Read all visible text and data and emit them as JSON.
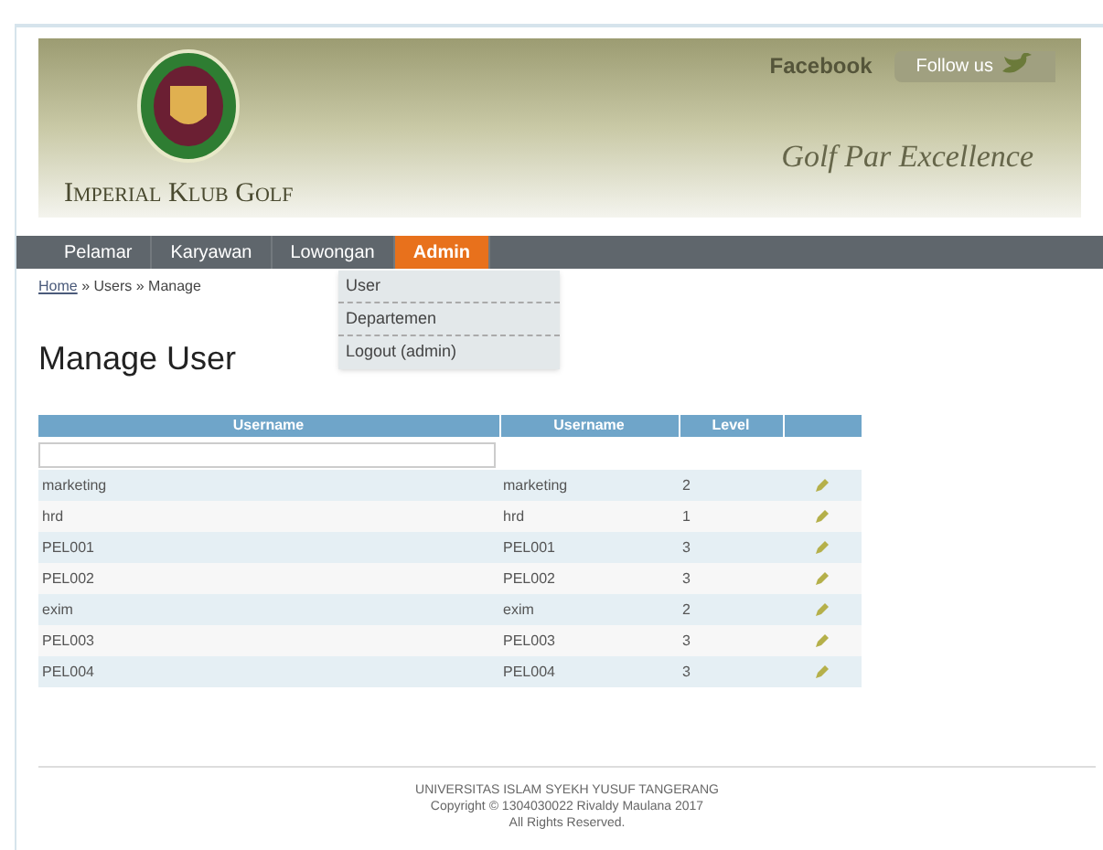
{
  "header": {
    "brand": "Imperial Klub Golf",
    "facebook": "Facebook",
    "follow": "Follow us",
    "tagline": "Golf Par Excellence"
  },
  "nav": [
    {
      "label": "Pelamar",
      "selected": false
    },
    {
      "label": "Karyawan",
      "selected": false
    },
    {
      "label": "Lowongan",
      "selected": false
    },
    {
      "label": "Admin",
      "selected": true
    }
  ],
  "dropdown": [
    "User",
    "Departemen",
    "Logout (admin)"
  ],
  "breadcrumb": {
    "home": "Home",
    "rest": "» Users » Manage"
  },
  "title": "Manage User",
  "table": {
    "columns": [
      "Username",
      "Username",
      "Level"
    ],
    "rows": [
      {
        "cells": [
          "marketing",
          "marketing",
          "2"
        ]
      },
      {
        "cells": [
          "hrd",
          "hrd",
          "1"
        ]
      },
      {
        "cells": [
          "PEL001",
          "PEL001",
          "3"
        ]
      },
      {
        "cells": [
          "PEL002",
          "PEL002",
          "3"
        ]
      },
      {
        "cells": [
          "exim",
          "exim",
          "2"
        ]
      },
      {
        "cells": [
          "PEL003",
          "PEL003",
          "3"
        ]
      },
      {
        "cells": [
          "PEL004",
          "PEL004",
          "3"
        ]
      }
    ]
  },
  "footer": [
    "UNIVERSITAS ISLAM SYEKH YUSUF TANGERANG",
    "Copyright © 1304030022 Rivaldy Maulana 2017",
    "All Rights Reserved."
  ]
}
